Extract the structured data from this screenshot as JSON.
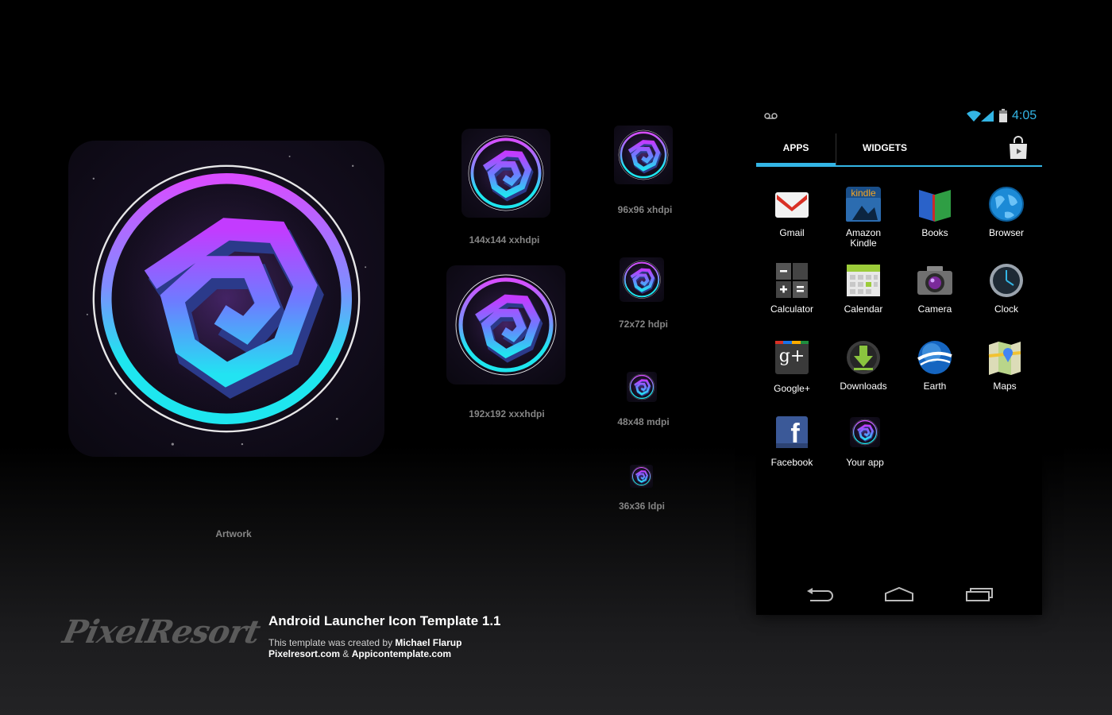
{
  "canvas": {
    "artwork_caption": "Artwork",
    "previews": [
      {
        "label": "144x144 xxhdpi"
      },
      {
        "label": "192x192 xxxhdpi"
      },
      {
        "label": "96x96 xhdpi"
      },
      {
        "label": "72x72 hdpi"
      },
      {
        "label": "48x48 mdpi"
      },
      {
        "label": "36x36 ldpi"
      }
    ]
  },
  "phone": {
    "status_time": "4:05",
    "tabs": {
      "apps": "APPS",
      "widgets": "WIDGETS"
    },
    "apps": [
      {
        "label": "Gmail",
        "icon": "gmail-icon"
      },
      {
        "label": "Amazon Kindle",
        "icon": "kindle-icon",
        "kindle_text": "kindle"
      },
      {
        "label": "Books",
        "icon": "books-icon"
      },
      {
        "label": "Browser",
        "icon": "browser-globe-icon"
      },
      {
        "label": "Calculator",
        "icon": "calculator-icon"
      },
      {
        "label": "Calendar",
        "icon": "calendar-icon"
      },
      {
        "label": "Camera",
        "icon": "camera-icon"
      },
      {
        "label": "Clock",
        "icon": "clock-icon"
      },
      {
        "label": "Google+",
        "icon": "google-plus-icon",
        "gplus_text": "g+"
      },
      {
        "label": "Downloads",
        "icon": "downloads-icon"
      },
      {
        "label": "Earth",
        "icon": "earth-icon"
      },
      {
        "label": "Maps",
        "icon": "maps-icon"
      },
      {
        "label": "Facebook",
        "icon": "facebook-icon",
        "fb_text": "f"
      },
      {
        "label": "Your app",
        "icon": "your-app-icon"
      }
    ],
    "accent_color": "#33b5e5"
  },
  "footer": {
    "logo": "PixelResort",
    "title": "Android Launcher Icon Template 1.1",
    "credit_prefix": "This template was created by ",
    "credit_name": "Michael Flarup",
    "link1": "Pixelresort.com",
    "link_sep": " & ",
    "link2": "Appicontemplate.com"
  },
  "colors": {
    "cyan": "#22e8f0",
    "magenta": "#c040ff",
    "background": "#000000"
  }
}
